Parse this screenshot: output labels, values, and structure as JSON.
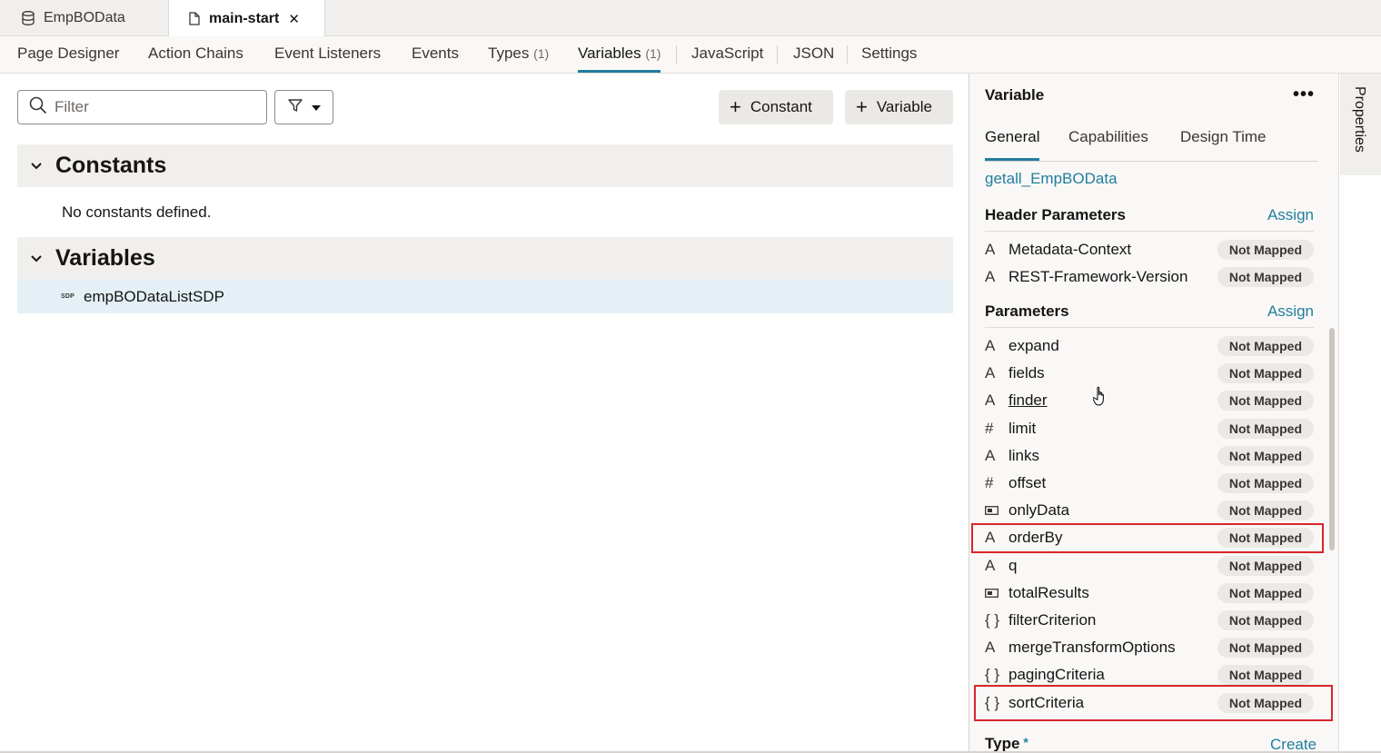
{
  "file_tabs": [
    {
      "label": "EmpBOData",
      "icon": "database-icon"
    },
    {
      "label": "main-start",
      "icon": "file-icon",
      "close": "✕"
    }
  ],
  "designer_tabs": [
    {
      "label": "Page Designer"
    },
    {
      "label": "Action Chains"
    },
    {
      "label": "Event Listeners"
    },
    {
      "label": "Events"
    },
    {
      "label": "Types",
      "count": "(1)"
    },
    {
      "label": "Variables",
      "count": "(1)"
    },
    {
      "label": "JavaScript"
    },
    {
      "label": "JSON"
    },
    {
      "label": "Settings"
    }
  ],
  "toolbar": {
    "filter_placeholder": "Filter",
    "constant_label": "Constant",
    "variable_label": "Variable"
  },
  "constants": {
    "title": "Constants",
    "empty_text": "No constants defined."
  },
  "variables": {
    "title": "Variables",
    "items": [
      {
        "badge": "SDP",
        "name": "empBODataListSDP"
      }
    ]
  },
  "properties": {
    "title": "Variable",
    "more": "•••",
    "tabs": [
      "General",
      "Capabilities",
      "Design Time"
    ],
    "endpoint": "getall_EmpBOData",
    "header_parameters": {
      "label": "Header Parameters",
      "assign": "Assign",
      "items": [
        {
          "type": "A",
          "name": "Metadata-Context",
          "status": "Not Mapped"
        },
        {
          "type": "A",
          "name": "REST-Framework-Version",
          "status": "Not Mapped"
        }
      ]
    },
    "parameters": {
      "label": "Parameters",
      "assign": "Assign",
      "items": [
        {
          "type": "A",
          "name": "expand",
          "status": "Not Mapped"
        },
        {
          "type": "A",
          "name": "fields",
          "status": "Not Mapped"
        },
        {
          "type": "A",
          "name": "finder",
          "status": "Not Mapped"
        },
        {
          "type": "#",
          "name": "limit",
          "status": "Not Mapped"
        },
        {
          "type": "A",
          "name": "links",
          "status": "Not Mapped"
        },
        {
          "type": "#",
          "name": "offset",
          "status": "Not Mapped"
        },
        {
          "type": "bool",
          "name": "onlyData",
          "status": "Not Mapped"
        },
        {
          "type": "A",
          "name": "orderBy",
          "status": "Not Mapped"
        },
        {
          "type": "A",
          "name": "q",
          "status": "Not Mapped"
        },
        {
          "type": "bool",
          "name": "totalResults",
          "status": "Not Mapped"
        },
        {
          "type": "{ }",
          "name": "filterCriterion",
          "status": "Not Mapped"
        },
        {
          "type": "A",
          "name": "mergeTransformOptions",
          "status": "Not Mapped"
        },
        {
          "type": "{ }",
          "name": "pagingCriteria",
          "status": "Not Mapped"
        },
        {
          "type": "{ }",
          "name": "sortCriteria",
          "status": "Not Mapped"
        }
      ]
    },
    "type_label": "Type",
    "type_required": "*",
    "create": "Create"
  },
  "sidebar": {
    "properties_tab": "Properties"
  },
  "colors": {
    "accent": "#227e9e",
    "highlight": "#d7262c",
    "selected_row": "#e4f0f5"
  }
}
